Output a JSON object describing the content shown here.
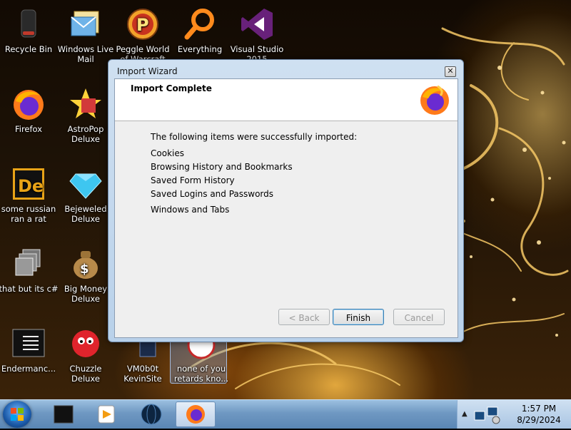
{
  "desktop": {
    "icons": [
      {
        "label": "Recycle Bin"
      },
      {
        "label": "Windows Live Mail"
      },
      {
        "label": "Peggle World of Warcraft"
      },
      {
        "label": "Everything"
      },
      {
        "label": "Visual Studio 2015"
      },
      {
        "label": "Firefox"
      },
      {
        "label": "AstroPop Deluxe"
      },
      {
        "label": "some russian ran a rat"
      },
      {
        "label": "Bejeweled Deluxe"
      },
      {
        "label": "that but its c#"
      },
      {
        "label": "Big Money Deluxe"
      },
      {
        "label": "Endermanc..."
      },
      {
        "label": "Chuzzle Deluxe"
      },
      {
        "label": "VM0b0t KevinSite"
      },
      {
        "label": "none of you retards kno..."
      }
    ]
  },
  "dialog": {
    "title": "Import Wizard",
    "close_glyph": "✕",
    "header_title": "Import Complete",
    "intro": "The following items were successfully imported:",
    "items": [
      "Cookies",
      "Browsing History and Bookmarks",
      "Saved Form History",
      "Saved Logins and Passwords",
      "Windows and Tabs"
    ],
    "buttons": {
      "back": "< Back",
      "finish": "Finish",
      "cancel": "Cancel"
    }
  },
  "taskbar": {
    "clock_time": "1:57 PM",
    "clock_date": "8/29/2024",
    "tray_arrow": "▲"
  },
  "colors": {
    "firefox_orange": "#ff7a1a",
    "firefox_purple": "#6a2bd1",
    "taskbar_blue": "#6f98c2"
  }
}
